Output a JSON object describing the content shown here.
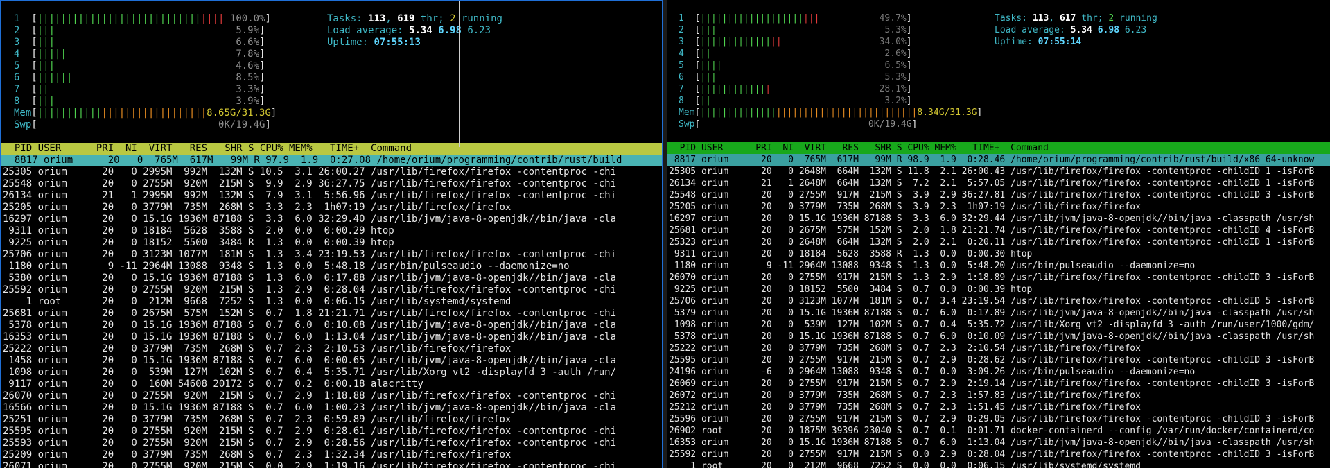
{
  "left": {
    "cpu_meters": [
      {
        "n": "1",
        "bar": "||||||||||||||||||||||||||||||||",
        "pct": "100.0%"
      },
      {
        "n": "2",
        "bar": "|||",
        "pct": "5.9%"
      },
      {
        "n": "3",
        "bar": "|||",
        "pct": "6.6%"
      },
      {
        "n": "4",
        "bar": "|||||",
        "pct": "7.8%"
      },
      {
        "n": "5",
        "bar": "|||",
        "pct": "4.6%"
      },
      {
        "n": "6",
        "bar": "||||||",
        "pct": "8.5%"
      },
      {
        "n": "7",
        "bar": "||",
        "pct": "3.3%"
      },
      {
        "n": "8",
        "bar": "|||",
        "pct": "3.9%"
      }
    ],
    "mem": {
      "label": "Mem",
      "bar": "|||||||||||||||||||||||||||||",
      "val": "8.65G/31.3G"
    },
    "swp": {
      "label": "Swp",
      "val": "0K/19.4G"
    },
    "tasks": {
      "label": "Tasks:",
      "count": "113",
      "thr": "619",
      "thr_label": "thr;",
      "running": "2",
      "running_label": "running"
    },
    "load": {
      "label": "Load average:",
      "a": "5.34",
      "b": "6.98",
      "c": "6.23"
    },
    "uptime": {
      "label": "Uptime:",
      "val": "07:55:13"
    },
    "header": "  PID USER      PRI  NI  VIRT   RES   SHR S CPU% MEM%   TIME+  Command",
    "rows": [
      "  8817 orium      20   0  765M  617M   99M R 97.9  1.9  0:27.08 /home/orium/programming/contrib/rust/build",
      "25305 orium      20   0 2995M  992M  132M S 10.5  3.1 26:00.27 /usr/lib/firefox/firefox -contentproc -chi",
      "25548 orium      20   0 2755M  920M  215M S  9.9  2.9 36:27.75 /usr/lib/firefox/firefox -contentproc -chi",
      "26134 orium      21   1 2995M  992M  132M S  7.9  3.1  5:56.96 /usr/lib/firefox/firefox -contentproc -chi",
      "25205 orium      20   0 3779M  735M  268M S  3.3  2.3  1h07:19 /usr/lib/firefox/firefox",
      "16297 orium      20   0 15.1G 1936M 87188 S  3.3  6.0 32:29.40 /usr/lib/jvm/java-8-openjdk//bin/java -cla",
      " 9311 orium      20   0 18184  5628  3588 S  2.0  0.0  0:00.29 htop",
      " 9225 orium      20   0 18152  5500  3484 R  1.3  0.0  0:00.39 htop",
      "25706 orium      20   0 3123M 1077M  181M S  1.3  3.4 23:19.53 /usr/lib/firefox/firefox -contentproc -chi",
      " 1180 orium       9 -11 2964M 13088  9348 S  1.3  0.0  5:48.18 /usr/bin/pulseaudio --daemonize=no",
      " 5380 orium      20   0 15.1G 1936M 87188 S  1.3  6.0  0:17.88 /usr/lib/jvm/java-8-openjdk//bin/java -cla",
      "25592 orium      20   0 2755M  920M  215M S  1.3  2.9  0:28.04 /usr/lib/firefox/firefox -contentproc -chi",
      "    1 root       20   0  212M  9668  7252 S  1.3  0.0  0:06.15 /usr/lib/systemd/systemd",
      "25681 orium      20   0 2675M  575M  152M S  0.7  1.8 21:21.71 /usr/lib/firefox/firefox -contentproc -chi",
      " 5378 orium      20   0 15.1G 1936M 87188 S  0.7  6.0  0:10.08 /usr/lib/jvm/java-8-openjdk//bin/java -cla",
      "16353 orium      20   0 15.1G 1936M 87188 S  0.7  6.0  1:13.04 /usr/lib/jvm/java-8-openjdk//bin/java -cla",
      "25222 orium      20   0 3779M  735M  268M S  0.7  2.3  2:10.53 /usr/lib/firefox/firefox",
      " 1458 orium      20   0 15.1G 1936M 87188 S  0.7  6.0  0:00.65 /usr/lib/jvm/java-8-openjdk//bin/java -cla",
      " 1098 orium      20   0  539M  127M  102M S  0.7  0.4  5:35.71 /usr/lib/Xorg vt2 -displayfd 3 -auth /run/",
      " 9117 orium      20   0  160M 54608 20172 S  0.7  0.2  0:00.18 alacritty",
      "26070 orium      20   0 2755M  920M  215M S  0.7  2.9  1:18.88 /usr/lib/firefox/firefox -contentproc -chi",
      "16566 orium      20   0 15.1G 1936M 87188 S  0.7  6.0  1:00.23 /usr/lib/jvm/java-8-openjdk//bin/java -cla",
      "25251 orium      20   0 3779M  735M  268M S  0.7  2.3  0:59.89 /usr/lib/firefox/firefox",
      "25595 orium      20   0 2755M  920M  215M S  0.7  2.9  0:28.61 /usr/lib/firefox/firefox -contentproc -chi",
      "25593 orium      20   0 2755M  920M  215M S  0.7  2.9  0:28.56 /usr/lib/firefox/firefox -contentproc -chi",
      "25209 orium      20   0 3779M  735M  268M S  0.7  2.3  1:32.34 /usr/lib/firefox/firefox",
      "26071 orium      20   0 2755M  920M  215M S  0.0  2.9  1:19.16 /usr/lib/firefox/firefox -contentproc -chi"
    ]
  },
  "right": {
    "cpu_meters": [
      {
        "n": "1",
        "bar": "||||||||||||||||||||||",
        "pct": "49.7%"
      },
      {
        "n": "2",
        "bar": "|||",
        "pct": "5.3%"
      },
      {
        "n": "3",
        "bar": "|||||||||||||||",
        "pct": "34.0%"
      },
      {
        "n": "4",
        "bar": "||",
        "pct": "2.6%"
      },
      {
        "n": "5",
        "bar": "||||",
        "pct": "6.5%"
      },
      {
        "n": "6",
        "bar": "|||",
        "pct": "5.3%"
      },
      {
        "n": "7",
        "bar": "|||||||||||||",
        "pct": "28.1%"
      },
      {
        "n": "8",
        "bar": "||",
        "pct": "3.2%"
      }
    ],
    "mem": {
      "label": "Mem",
      "bar": "||||||||||||||||||||||||||||||||||||||||",
      "val": "8.34G/31.3G"
    },
    "swp": {
      "label": "Swp",
      "val": "0K/19.4G"
    },
    "tasks": {
      "label": "Tasks:",
      "count": "113",
      "thr": "617",
      "thr_label": "thr;",
      "running": "2",
      "running_label": "running"
    },
    "load": {
      "label": "Load average:",
      "a": "5.34",
      "b": "6.98",
      "c": "6.23"
    },
    "uptime": {
      "label": "Uptime:",
      "val": "07:55:14"
    },
    "header": "  PID USER      PRI  NI  VIRT   RES   SHR S CPU% MEM%   TIME+  Command",
    "rows": [
      " 8817 orium      20   0  765M  617M   99M R 98.9  1.9  0:28.46 /home/orium/programming/contrib/rust/build/x86_64-unknow",
      "25305 orium      20   0 2648M  664M  132M S 11.8  2.1 26:00.43 /usr/lib/firefox/firefox -contentproc -childID 1 -isForB",
      "26134 orium      21   1 2648M  664M  132M S  7.2  2.1  5:57.05 /usr/lib/firefox/firefox -contentproc -childID 1 -isForB",
      "25548 orium      20   0 2755M  917M  215M S  3.9  2.9 36:27.81 /usr/lib/firefox/firefox -contentproc -childID 3 -isForB",
      "25205 orium      20   0 3779M  735M  268M S  3.9  2.3  1h07:19 /usr/lib/firefox/firefox",
      "16297 orium      20   0 15.1G 1936M 87188 S  3.3  6.0 32:29.44 /usr/lib/jvm/java-8-openjdk//bin/java -classpath /usr/sh",
      "25681 orium      20   0 2675M  575M  152M S  2.0  1.8 21:21.74 /usr/lib/firefox/firefox -contentproc -childID 4 -isForB",
      "25323 orium      20   0 2648M  664M  132M S  2.0  2.1  0:20.11 /usr/lib/firefox/firefox -contentproc -childID 1 -isForB",
      " 9311 orium      20   0 18184  5628  3588 R  1.3  0.0  0:00.30 htop",
      " 1180 orium       9 -11 2964M 13088  9348 S  1.3  0.0  5:48.20 /usr/bin/pulseaudio --daemonize=no",
      "26070 orium      20   0 2755M  917M  215M S  1.3  2.9  1:18.89 /usr/lib/firefox/firefox -contentproc -childID 3 -isForB",
      " 9225 orium      20   0 18152  5500  3484 S  0.7  0.0  0:00.39 htop",
      "25706 orium      20   0 3123M 1077M  181M S  0.7  3.4 23:19.54 /usr/lib/firefox/firefox -contentproc -childID 5 -isForB",
      " 5379 orium      20   0 15.1G 1936M 87188 S  0.7  6.0  0:17.89 /usr/lib/jvm/java-8-openjdk//bin/java -classpath /usr/sh",
      " 1098 orium      20   0  539M  127M  102M S  0.7  0.4  5:35.72 /usr/lib/Xorg vt2 -displayfd 3 -auth /run/user/1000/gdm/",
      " 5378 orium      20   0 15.1G 1936M 87188 S  0.7  6.0  0:10.09 /usr/lib/jvm/java-8-openjdk//bin/java -classpath /usr/sh",
      "25222 orium      20   0 3779M  735M  268M S  0.7  2.3  2:10.54 /usr/lib/firefox/firefox",
      "25595 orium      20   0 2755M  917M  215M S  0.7  2.9  0:28.62 /usr/lib/firefox/firefox -contentproc -childID 3 -isForB",
      "24196 orium      -6   0 2964M 13088  9348 S  0.7  0.0  3:09.26 /usr/bin/pulseaudio --daemonize=no",
      "26069 orium      20   0 2755M  917M  215M S  0.7  2.9  2:19.14 /usr/lib/firefox/firefox -contentproc -childID 3 -isForB",
      "26072 orium      20   0 3779M  735M  268M S  0.7  2.3  1:57.83 /usr/lib/firefox/firefox",
      "25212 orium      20   0 3779M  735M  268M S  0.7  2.3  1:51.45 /usr/lib/firefox/firefox",
      "25596 orium      20   0 2755M  917M  215M S  0.7  2.9  0:29.05 /usr/lib/firefox/firefox -contentproc -childID 3 -isForB",
      "26902 root       20   0 1875M 39396 23040 S  0.7  0.1  0:01.71 docker-containerd --config /var/run/docker/containerd/co",
      "16353 orium      20   0 15.1G 1936M 87188 S  0.7  6.0  1:13.04 /usr/lib/jvm/java-8-openjdk//bin/java -classpath /usr/sh",
      "25592 orium      20   0 2755M  917M  215M S  0.0  2.9  0:28.04 /usr/lib/firefox/firefox -contentproc -childID 3 -isForB",
      "    1 root       20   0  212M  9668  7252 S  0.0  0.0  0:06.15 /usr/lib/systemd/systemd"
    ]
  }
}
